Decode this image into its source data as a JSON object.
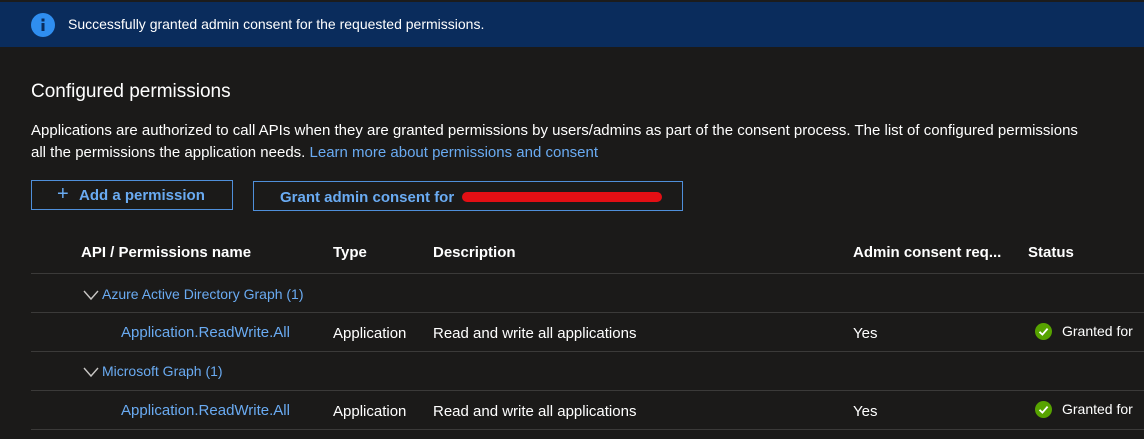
{
  "banner": {
    "message": "Successfully granted admin consent for the requested permissions.",
    "icon": "info-icon",
    "background": "#0a2c5c"
  },
  "section": {
    "title": "Configured permissions",
    "description_line1": "Applications are authorized to call APIs when they are granted permissions by users/admins as part of the consent process. The list of configured permissions",
    "description_line2": "all the permissions the application needs.",
    "learn_more": "Learn more about permissions and consent"
  },
  "actions": {
    "add_permission": "Add a permission",
    "grant_consent": "Grant admin consent for"
  },
  "table": {
    "headers": [
      "API / Permissions name",
      "Type",
      "Description",
      "Admin consent req...",
      "Status"
    ],
    "groups": [
      {
        "name": "Azure Active Directory Graph (1)",
        "rows": [
          {
            "permission": "Application.ReadWrite.All",
            "type": "Application",
            "description": "Read and write all applications",
            "admin_consent": "Yes",
            "status": "Granted for"
          }
        ]
      },
      {
        "name": "Microsoft Graph (1)",
        "rows": [
          {
            "permission": "Application.ReadWrite.All",
            "type": "Application",
            "description": "Read and write all applications",
            "admin_consent": "Yes",
            "status": "Granted for"
          }
        ]
      }
    ]
  },
  "colors": {
    "accent": "#6aabf2",
    "success": "#57a300",
    "redaction": "#e30f14"
  }
}
